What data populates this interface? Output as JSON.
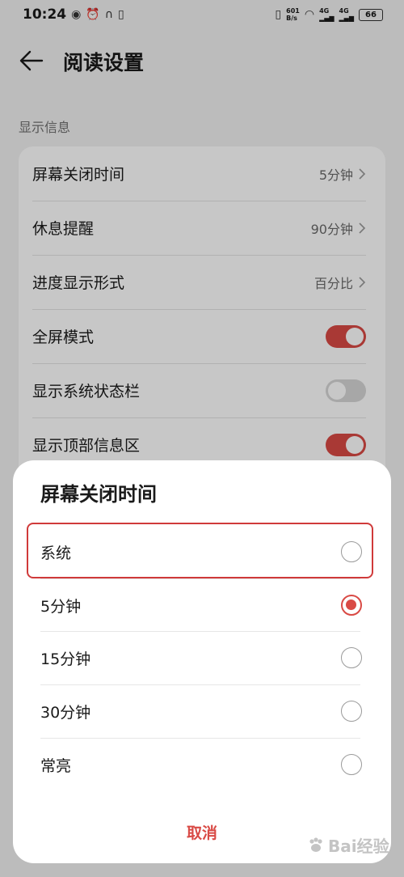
{
  "status_bar": {
    "time": "10:24",
    "left_icons": [
      "eye-icon",
      "alarm-icon",
      "headphones-icon",
      "sim-icon"
    ],
    "net_speed_value": "601",
    "net_speed_unit": "B/s",
    "signal_label_1": "4G",
    "signal_label_2": "4G",
    "battery": "66"
  },
  "header": {
    "title": "阅读设置"
  },
  "section": {
    "label": "显示信息"
  },
  "settings": {
    "rows": [
      {
        "label": "屏幕关闭时间",
        "value": "5分钟",
        "type": "link"
      },
      {
        "label": "休息提醒",
        "value": "90分钟",
        "type": "link"
      },
      {
        "label": "进度显示形式",
        "value": "百分比",
        "type": "link"
      },
      {
        "label": "全屏模式",
        "type": "toggle",
        "on": true
      },
      {
        "label": "显示系统状态栏",
        "type": "toggle",
        "on": false
      },
      {
        "label": "显示顶部信息区",
        "type": "toggle",
        "on": true
      }
    ]
  },
  "dialog": {
    "title": "屏幕关闭时间",
    "options": [
      {
        "label": "系统",
        "selected": false
      },
      {
        "label": "5分钟",
        "selected": true
      },
      {
        "label": "15分钟",
        "selected": false
      },
      {
        "label": "30分钟",
        "selected": false
      },
      {
        "label": "常亮",
        "selected": false
      }
    ],
    "cancel": "取消"
  },
  "watermark": {
    "text": "Bai经验"
  },
  "colors": {
    "accent": "#d94a45",
    "highlight": "#d03a3a"
  }
}
